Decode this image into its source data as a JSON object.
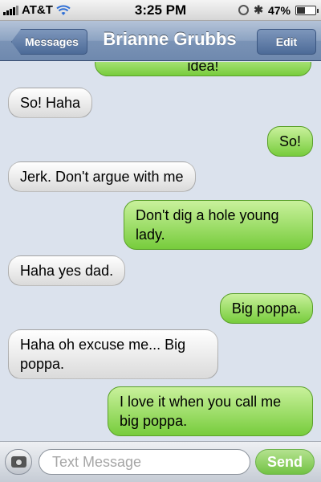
{
  "status_bar": {
    "carrier": "AT&T",
    "time": "3:25 PM",
    "battery": "47%",
    "battery_level": 0.47,
    "icons": [
      "signal-icon",
      "wifi-icon",
      "clock-icon",
      "bluetooth-icon",
      "battery-icon"
    ]
  },
  "nav": {
    "back_label": "Messages",
    "title": "Brianne Grubbs",
    "edit_label": "Edit"
  },
  "messages": [
    {
      "sender": "me",
      "text": "idea!"
    },
    {
      "sender": "them",
      "text": "So! Haha"
    },
    {
      "sender": "me",
      "text": "So!"
    },
    {
      "sender": "them",
      "text": "Jerk. Don't argue with me"
    },
    {
      "sender": "me",
      "text": "Don't dig a hole young lady."
    },
    {
      "sender": "them",
      "text": "Haha yes dad."
    },
    {
      "sender": "me",
      "text": "Big poppa."
    },
    {
      "sender": "them",
      "text": "Haha oh excuse me... Big poppa."
    },
    {
      "sender": "me",
      "text": "I love it when you call me big poppa."
    }
  ],
  "composer": {
    "placeholder": "Text Message",
    "send_label": "Send",
    "camera_icon": "camera-icon"
  },
  "colors": {
    "incoming_bubble": "#ffffff",
    "outgoing_bubble": "#77cc3c",
    "nav_bar": "#6f89ae",
    "background": "#dbe2ed"
  }
}
